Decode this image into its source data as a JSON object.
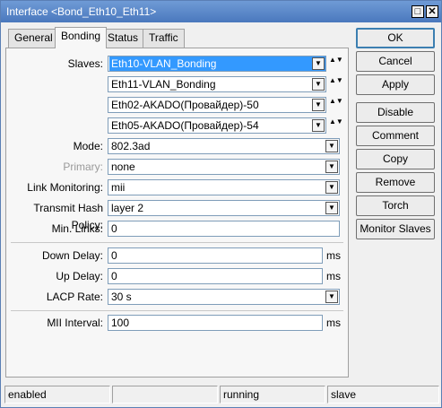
{
  "window": {
    "title": "Interface <Bond_Eth10_Eth11>",
    "restore_glyph": "□",
    "close_glyph": "✕"
  },
  "tabs": [
    "General",
    "Bonding",
    "Status",
    "Traffic"
  ],
  "active_tab": "Bonding",
  "form": {
    "slaves_label": "Slaves:",
    "slaves": [
      "Eth10-VLAN_Bonding",
      "Eth11-VLAN_Bonding",
      "Eth02-AKADO(Провайдер)-50",
      "Eth05-AKADO(Провайдер)-54"
    ],
    "mode_label": "Mode:",
    "mode": "802.3ad",
    "primary_label": "Primary:",
    "primary": "none",
    "link_monitoring_label": "Link Monitoring:",
    "link_monitoring": "mii",
    "transmit_hash_label": "Transmit Hash Policy:",
    "transmit_hash": "layer 2",
    "min_links_label": "Min. Links:",
    "min_links": "0",
    "down_delay_label": "Down Delay:",
    "down_delay": "0",
    "up_delay_label": "Up Delay:",
    "up_delay": "0",
    "lacp_rate_label": "LACP Rate:",
    "lacp_rate": "30 s",
    "mii_interval_label": "MII Interval:",
    "mii_interval": "100",
    "unit_ms": "ms"
  },
  "buttons": {
    "ok": "OK",
    "cancel": "Cancel",
    "apply": "Apply",
    "disable": "Disable",
    "comment": "Comment",
    "copy": "Copy",
    "remove": "Remove",
    "torch": "Torch",
    "monitor_slaves": "Monitor Slaves"
  },
  "status": {
    "state": "enabled",
    "empty": "",
    "running": "running",
    "slave": "slave"
  },
  "icons": {
    "dropdown": "▼",
    "updown": "▲▼"
  },
  "colors": {
    "titlebar": "#4a78bd",
    "selection": "#3399ff"
  }
}
